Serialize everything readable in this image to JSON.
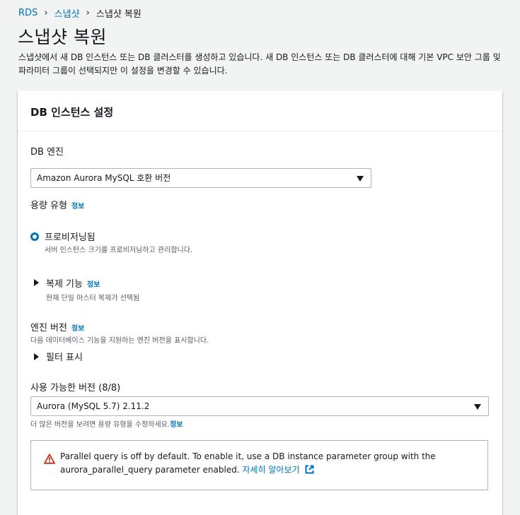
{
  "breadcrumb": {
    "items": [
      "RDS",
      "스냅샷",
      "스냅샷 복원"
    ]
  },
  "page": {
    "title": "스냅샷 복원",
    "description": "스냅샷에서 새 DB 인스턴스 또는 DB 클러스터를 생성하고 있습니다. 새 DB 인스턴스 또는 DB 클러스터에 대해 기본 VPC 보안 그룹 및 파라미터 그룹이 선택되지만 이 설정을 변경할 수 있습니다."
  },
  "panel": {
    "title": "DB 인스턴스 설정",
    "db_engine": {
      "label": "DB 엔진",
      "selected": "Amazon Aurora MySQL 호환 버전"
    },
    "capacity_type": {
      "label": "용량 유형",
      "info": "정보",
      "option_label": "프로비저닝됨",
      "option_desc": "서버 인스턴스 크기를 프로비저닝하고 관리합니다."
    },
    "replication": {
      "label": "복제 기능",
      "info": "정보",
      "desc": "현재 단일 마스터 복제가 선택됨"
    },
    "engine_version": {
      "label": "엔진 버전",
      "info": "정보",
      "desc": "다음 데이터베이스 기능을 지원하는 엔진 버전을 표시합니다.",
      "filter_label": "필터 표시"
    },
    "available_versions": {
      "label": "사용 가능한 버전 (8/8)",
      "selected": "Aurora (MySQL 5.7) 2.11.2",
      "hint": "더 많은 버전을 보려면 용량 유형을 수정하세요.",
      "hint_info": "정보"
    },
    "alert": {
      "text": "Parallel query is off by default. To enable it, use a DB instance parameter group with the aurora_parallel_query parameter enabled. ",
      "link": "자세히 알아보기",
      "warning_color": "#d13212"
    }
  },
  "colors": {
    "link": "#0073bb",
    "background": "#f2f3f3"
  }
}
